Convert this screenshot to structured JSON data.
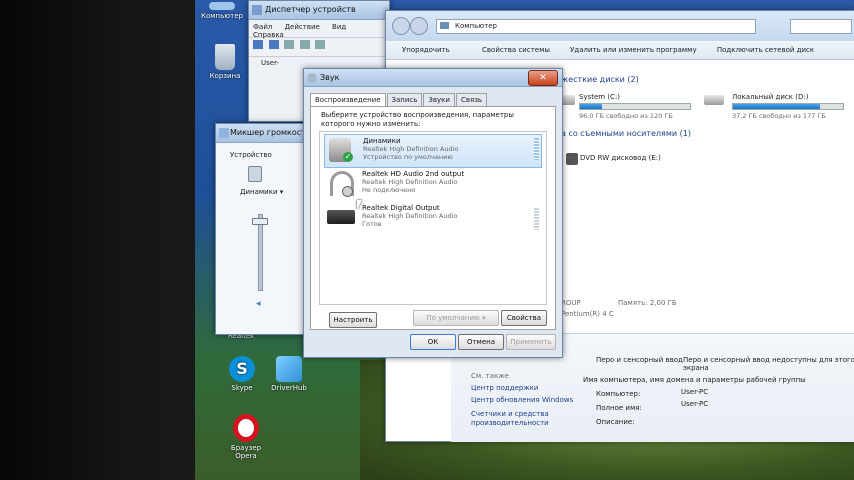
{
  "desktop": {
    "icons": [
      {
        "label": "Компьютер"
      },
      {
        "label": "Корзина"
      },
      {
        "label": "Skype"
      },
      {
        "label": "DriverHub"
      },
      {
        "label": "Браузер Opera"
      }
    ],
    "partial_label": "Realtek"
  },
  "device_manager": {
    "title": "Диспетчер устройств",
    "menu": [
      "Файл",
      "Действие",
      "Вид",
      "Справка"
    ],
    "tree_root": "User-"
  },
  "explorer": {
    "address": "Компьютер",
    "toolbar": [
      "Упорядочить",
      "Свойства системы",
      "Удалить или изменить программу",
      "Подключить сетевой диск"
    ],
    "hdd_header": "жесткие диски (2)",
    "drives": [
      {
        "name": "System (C:)",
        "free": "96,0 ГБ свободно из 120 ГБ",
        "fill": 0.2
      },
      {
        "name": "Локальный диск (D:)",
        "free": "37,2 ГБ свободно из 177 ГБ",
        "fill": 0.79
      }
    ],
    "removable_header": "а со съемными носителями (1)",
    "dvd": "DVD RW дисковод (E:)",
    "workgroup": "ROUP",
    "memory": "Память: 2,00 ГБ",
    "processor": "Pentium(R) 4 C",
    "pen_left": "Перо и сенсорный ввод",
    "pen_right": "Перо и сенсорный ввод недоступны для этого экрана",
    "see_also": "См. также",
    "see_also_links": [
      "Центр поддержки",
      "Центр обновления Windows",
      "Счетчики и средства производительности"
    ],
    "name_header": "Имя компьютера, имя домена и параметры рабочей группы",
    "name_rows": [
      {
        "label": "Компьютер:",
        "value": "User-PC"
      },
      {
        "label": "Полное имя:",
        "value": "User-PC"
      },
      {
        "label": "Описание:",
        "value": ""
      }
    ]
  },
  "mixer": {
    "title": "Микшер громкости",
    "device_label": "Устройство",
    "device_name": "Динамики",
    "volume": 0.95
  },
  "sound_dialog": {
    "title": "Звук",
    "tabs": [
      "Воспроизведение",
      "Запись",
      "Звуки",
      "Связь"
    ],
    "instruction": "Выберите устройство воспроизведения, параметры которого нужно изменить:",
    "devices": [
      {
        "name": "Динамики",
        "driver": "Realtek High Definition Audio",
        "status": "Устройство по умолчанию"
      },
      {
        "name": "Realtek HD Audio 2nd output",
        "driver": "Realtek High Definition Audio",
        "status": "Не подключено"
      },
      {
        "name": "Realtek Digital Output",
        "driver": "Realtek High Definition Audio",
        "status": "Готов"
      }
    ],
    "configure": "Настроить",
    "default_btn": "По умолчанию",
    "properties": "Свойства",
    "ok": "ОК",
    "cancel": "Отмена",
    "apply": "Применить"
  }
}
